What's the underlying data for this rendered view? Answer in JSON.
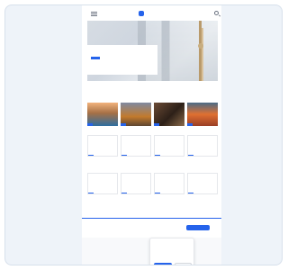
{
  "header": {
    "menu_icon": "menu-icon",
    "logo_text": "",
    "search_icon": "search-icon"
  },
  "hero": {
    "tag": "",
    "title": "",
    "meta": ""
  },
  "section": {
    "title": ""
  },
  "articles": [
    {
      "tag": "",
      "title": ""
    },
    {
      "tag": "",
      "title": ""
    },
    {
      "tag": "",
      "title": ""
    },
    {
      "tag": "",
      "title": ""
    },
    {
      "tag": "",
      "title": ""
    },
    {
      "tag": "",
      "title": ""
    },
    {
      "tag": "",
      "title": ""
    },
    {
      "tag": "",
      "title": ""
    },
    {
      "tag": "",
      "title": ""
    },
    {
      "tag": "",
      "title": ""
    },
    {
      "tag": "",
      "title": ""
    },
    {
      "tag": "",
      "title": ""
    }
  ],
  "newsletter": {
    "text": "",
    "button_label": ""
  },
  "footer": {
    "text": ""
  },
  "cookie_banner": {
    "title": "",
    "text": "",
    "accept_label": "",
    "reject_label": ""
  },
  "colors": {
    "accent": "#2563eb",
    "card_background": "#eef3f9",
    "page_background": "#ffffff"
  }
}
